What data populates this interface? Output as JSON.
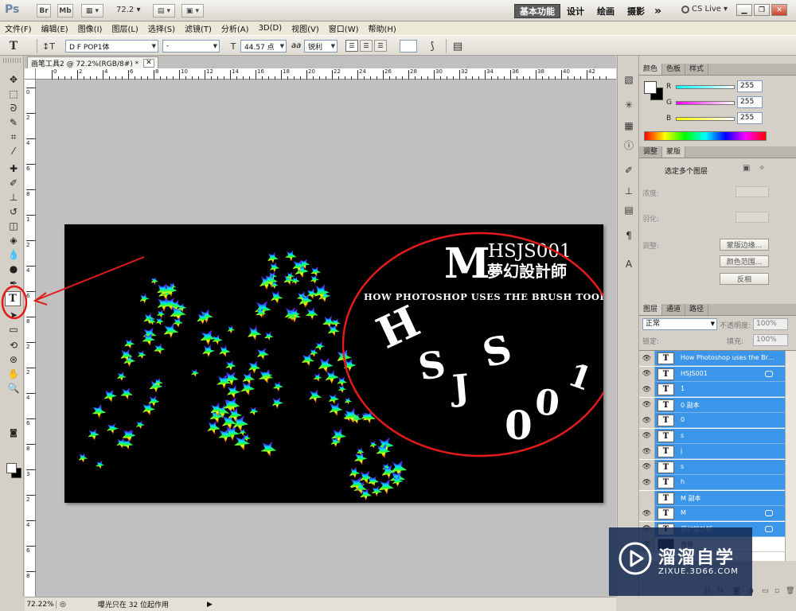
{
  "titlebar": {
    "logo": "Ps",
    "btn_br": "Br",
    "btn_mb": "Mb",
    "zoom": "72.2",
    "workspaces": [
      "基本功能",
      "设计",
      "绘画",
      "摄影"
    ],
    "more": "»",
    "cslive": "CS Live"
  },
  "menu": [
    "文件(F)",
    "编辑(E)",
    "图像(I)",
    "图层(L)",
    "选择(S)",
    "滤镜(T)",
    "分析(A)",
    "3D(D)",
    "视图(V)",
    "窗口(W)",
    "帮助(H)"
  ],
  "options": {
    "font_family": "D F POP1体",
    "font_style": "-",
    "font_size": "44.57 点",
    "aa_label": "aa",
    "antialias": "锐利"
  },
  "document": {
    "tab_title": "画笔工具2 @ 72.2%(RGB/8#) *",
    "ruler_top": [
      "0",
      "2",
      "4",
      "6",
      "8",
      "10",
      "12",
      "14",
      "16",
      "18",
      "20",
      "22",
      "24",
      "26",
      "28",
      "30",
      "32",
      "34",
      "36",
      "38",
      "40",
      "42"
    ],
    "ruler_left": [
      "0",
      "2",
      "4",
      "6",
      "8",
      "1",
      "2",
      "4",
      "6",
      "8",
      "2",
      "2",
      "4",
      "6",
      "8",
      "3",
      "2",
      "4",
      "6",
      "8"
    ]
  },
  "artwork": {
    "big_letter": "M",
    "brand": "HSJS001",
    "chinese": "夢幻設計師",
    "tagline": "HOW PHOTOSHOP USES THE BRUSH TOOL",
    "arc_chars": [
      "H",
      "S",
      "J",
      "S",
      "0",
      "0",
      "1"
    ]
  },
  "status": {
    "zoom": "72.22%",
    "message": "曝光只在 32 位起作用"
  },
  "color_panel": {
    "tabs": [
      "颜色",
      "色板",
      "样式"
    ],
    "channels": [
      {
        "label": "R",
        "value": "255",
        "color": "#00e0f0"
      },
      {
        "label": "G",
        "value": "255",
        "color": "#e020e0"
      },
      {
        "label": "B",
        "value": "255",
        "color": "#f0f000"
      }
    ]
  },
  "adjust_panel": {
    "tabs": [
      "调整",
      "蒙版"
    ],
    "header": "选定多个图层",
    "density": "浓度:",
    "feather": "羽化:",
    "refine": "调整:",
    "btn_mask_edge": "蒙版边缘...",
    "btn_color_range": "颜色范围...",
    "btn_invert": "反相"
  },
  "layers_panel": {
    "tabs": [
      "图层",
      "通道",
      "路径"
    ],
    "blend_mode": "正常",
    "opacity_label": "不透明度:",
    "opacity": "100%",
    "lock_label": "锁定:",
    "fill_label": "填充:",
    "fill": "100%",
    "layers": [
      {
        "name": "How Photoshop uses the Bru...",
        "visible": true,
        "fx": false
      },
      {
        "name": "HSJS001",
        "visible": true,
        "fx": true
      },
      {
        "name": "1",
        "visible": true,
        "fx": false
      },
      {
        "name": "0 副本",
        "visible": true,
        "fx": false
      },
      {
        "name": "0",
        "visible": true,
        "fx": false
      },
      {
        "name": "s",
        "visible": true,
        "fx": false
      },
      {
        "name": "j",
        "visible": true,
        "fx": false
      },
      {
        "name": "s",
        "visible": true,
        "fx": false
      },
      {
        "name": "h",
        "visible": true,
        "fx": false
      },
      {
        "name": "M 副本",
        "visible": false,
        "fx": false
      },
      {
        "name": "M",
        "visible": true,
        "fx": true
      },
      {
        "name": "夢幻設計師",
        "visible": true,
        "fx": true
      }
    ],
    "bottom_layer": "背景"
  },
  "watermark": {
    "title": "溜溜自学",
    "url": "ZIXUE.3D66.COM"
  }
}
